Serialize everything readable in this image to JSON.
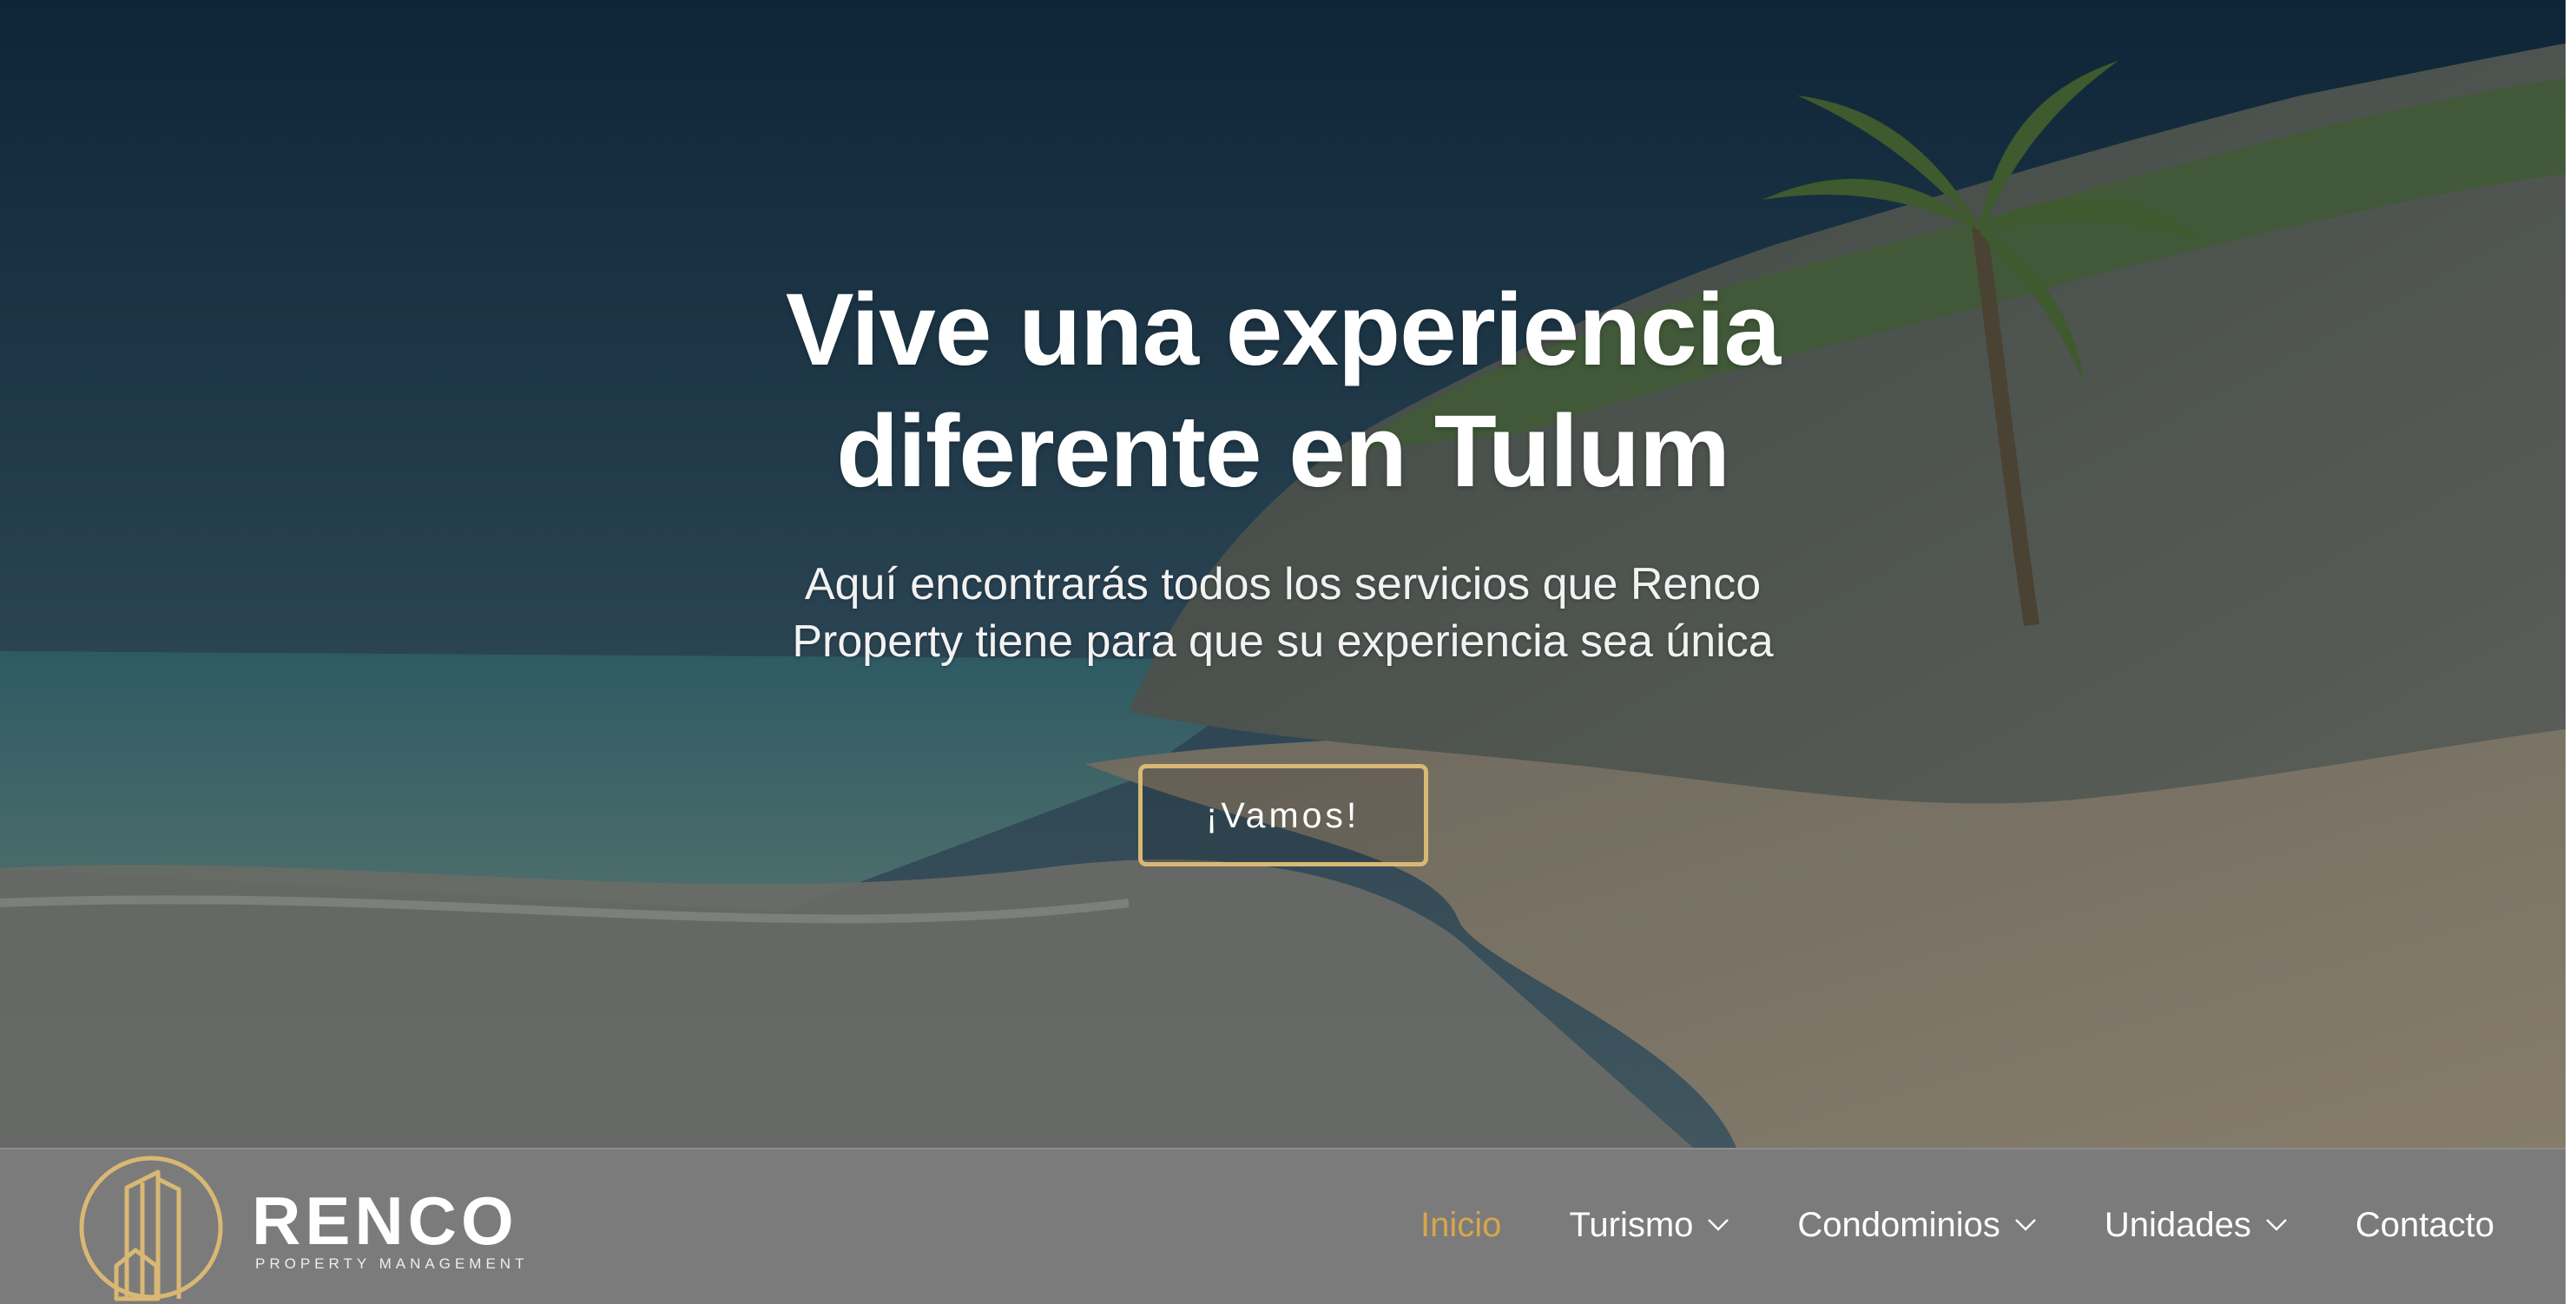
{
  "hero": {
    "headline_line1": "Vive una experiencia",
    "headline_line2": "diferente en Tulum",
    "subtext_line1": "Aquí encontrarás todos los servicios que Renco",
    "subtext_line2": "Property tiene para que su experiencia sea única",
    "cta_label": "¡Vamos!"
  },
  "brand": {
    "name": "RENCO",
    "tagline": "PROPERTY MANAGEMENT",
    "logo_icon": "building-circle-logo-icon"
  },
  "nav": {
    "items": [
      {
        "label": "Inicio",
        "active": true,
        "has_dropdown": false
      },
      {
        "label": "Turismo",
        "active": false,
        "has_dropdown": true
      },
      {
        "label": "Condominios",
        "active": false,
        "has_dropdown": true
      },
      {
        "label": "Unidades",
        "active": false,
        "has_dropdown": true
      },
      {
        "label": "Contacto",
        "active": false,
        "has_dropdown": false
      }
    ]
  },
  "colors": {
    "accent_gold": "#d8b873",
    "active_nav": "#d8a54d",
    "navbar_bg": "#7b7b7b"
  }
}
